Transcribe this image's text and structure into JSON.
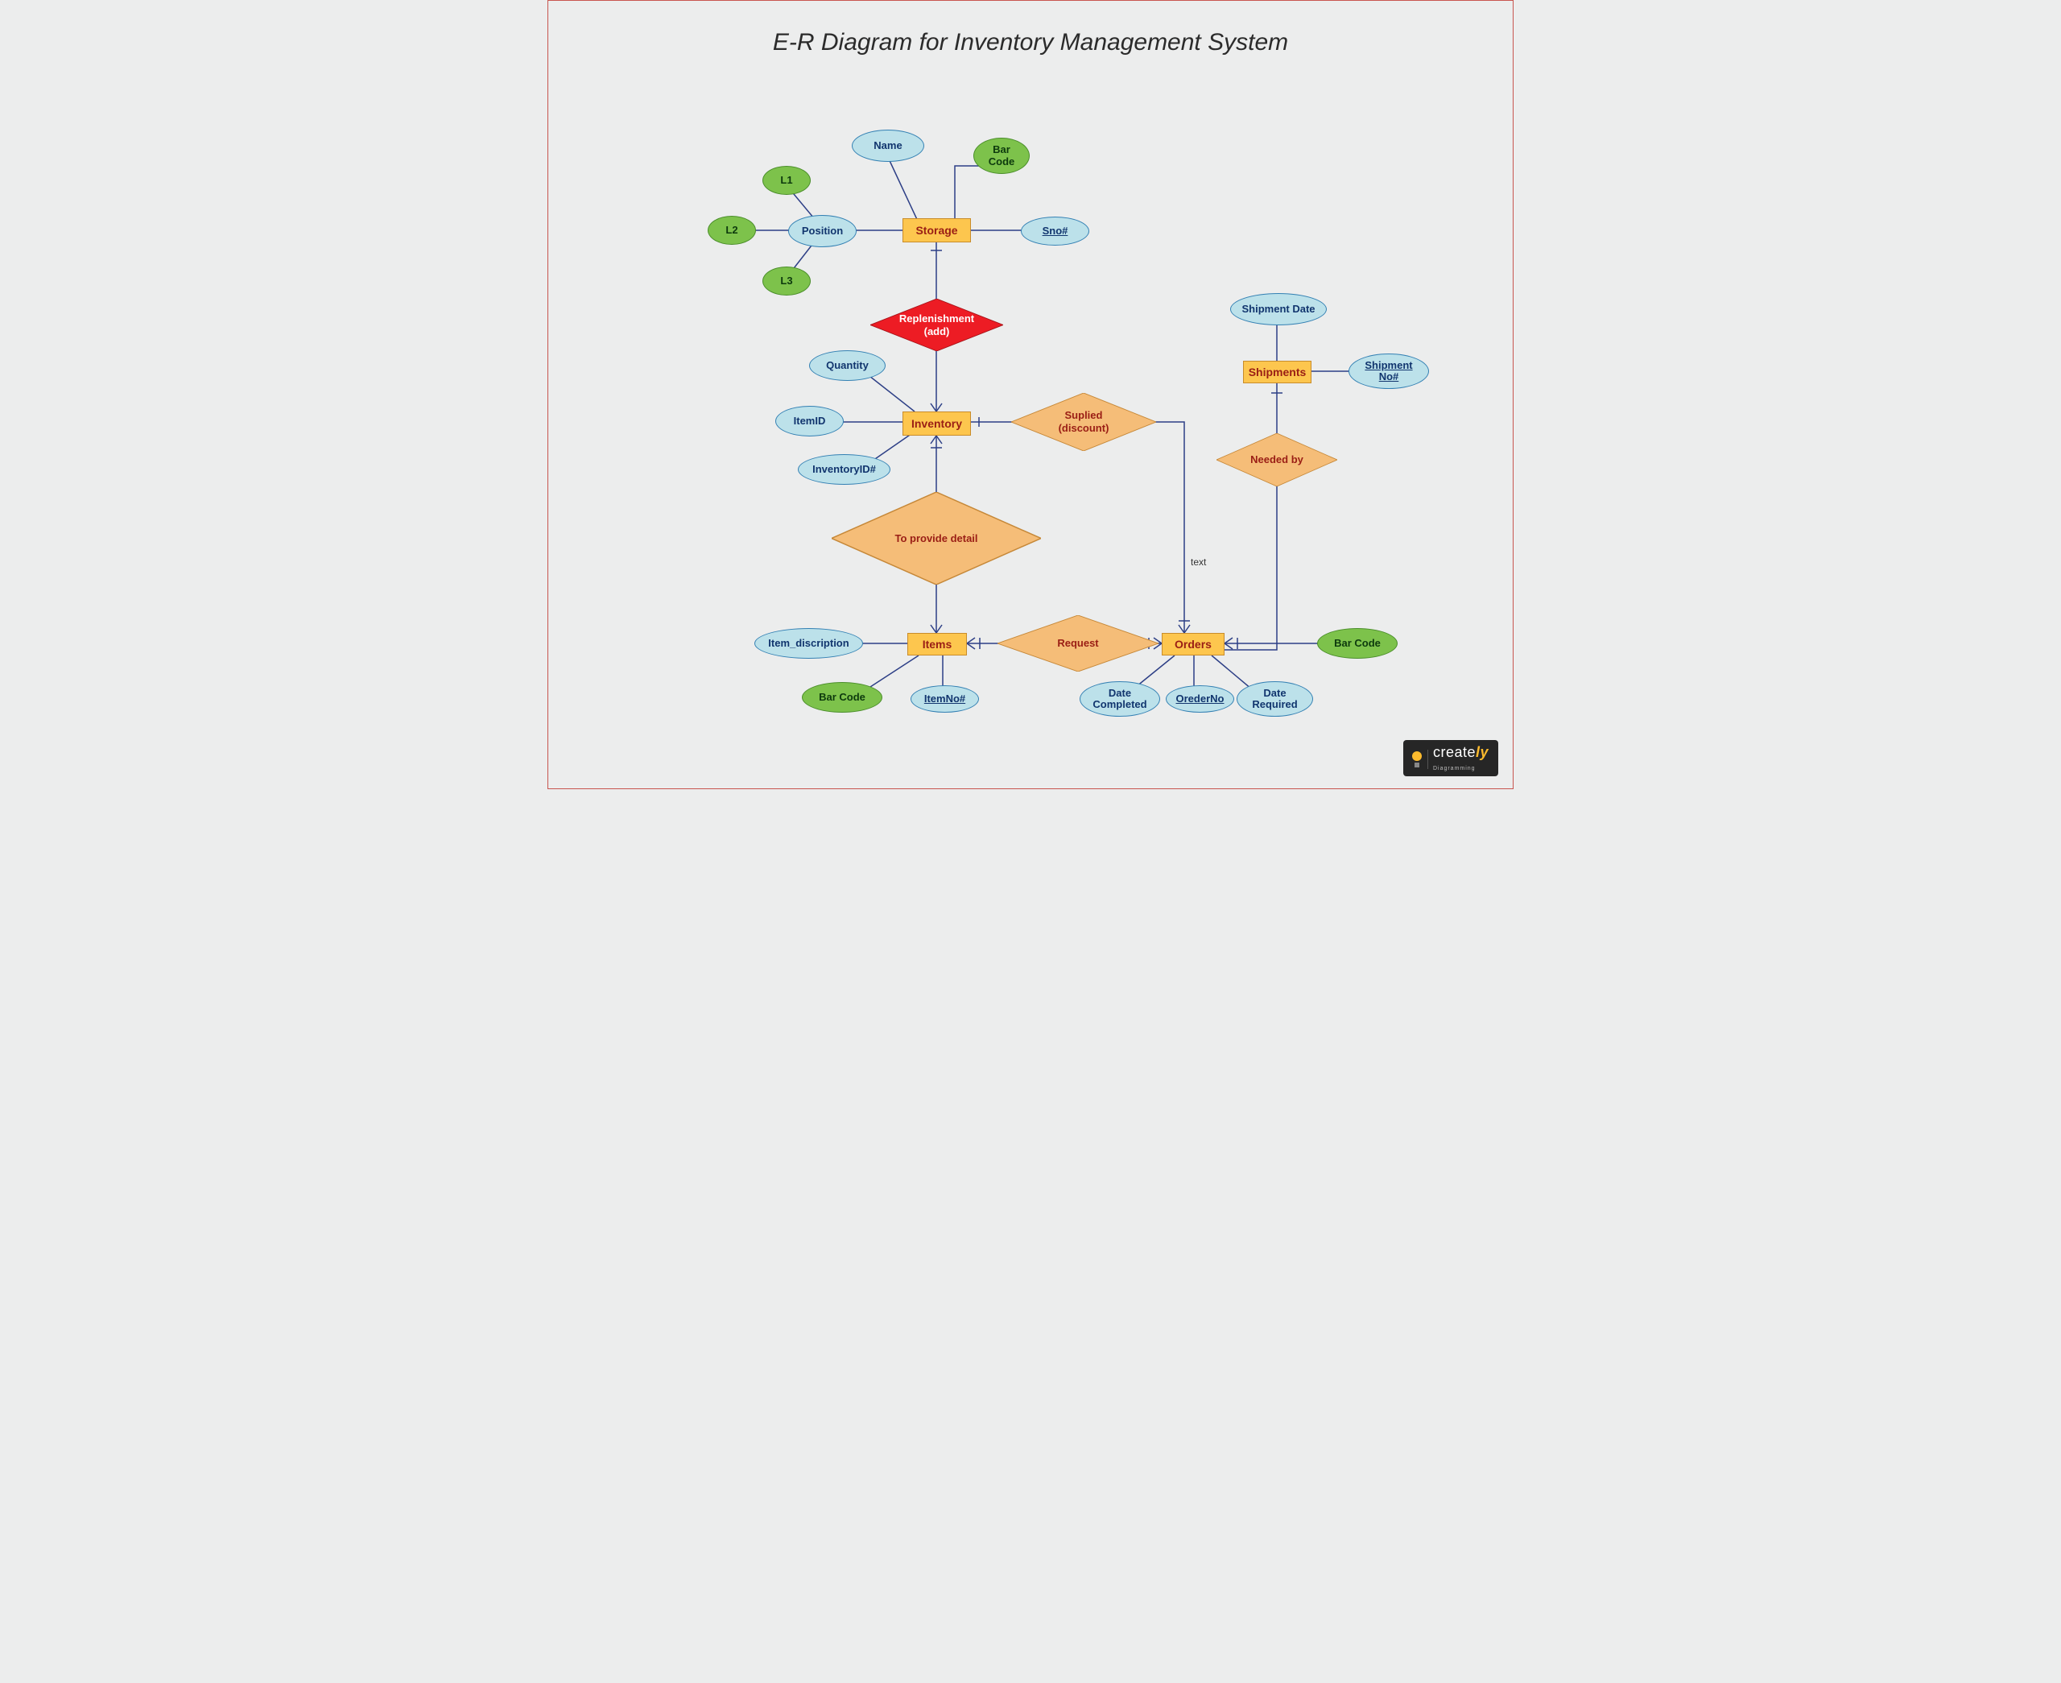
{
  "title": "E-R Diagram for Inventory Management System",
  "entities": {
    "storage": "Storage",
    "inventory": "Inventory",
    "items": "Items",
    "orders": "Orders",
    "shipments": "Shipments"
  },
  "relationships": {
    "replenishment": "Replenishment\n(add)",
    "suplied": "Suplied\n(discount)",
    "to_provide_detail": "To provide detail",
    "request": "Request",
    "needed_by": "Needed by"
  },
  "attributes": {
    "name": "Name",
    "bar_code_storage": "Bar\nCode",
    "sno": "Sno#",
    "position": "Position",
    "l1": "L1",
    "l2": "L2",
    "l3": "L3",
    "quantity": "Quantity",
    "item_id": "ItemID",
    "inventory_id": "InventoryID#",
    "item_discription": "Item_discription",
    "item_no": "ItemNo#",
    "bar_code_items": "Bar Code",
    "order_no": "OrederNo",
    "date_completed": "Date\nCompleted",
    "date_required": "Date\nRequired",
    "bar_code_orders": "Bar Code",
    "shipment_date": "Shipment Date",
    "shipment_no": "Shipment\nNo#"
  },
  "labels": {
    "text": "text"
  },
  "logo": {
    "brand": "create",
    "suffix": "ly",
    "tag": "Diagramming"
  }
}
